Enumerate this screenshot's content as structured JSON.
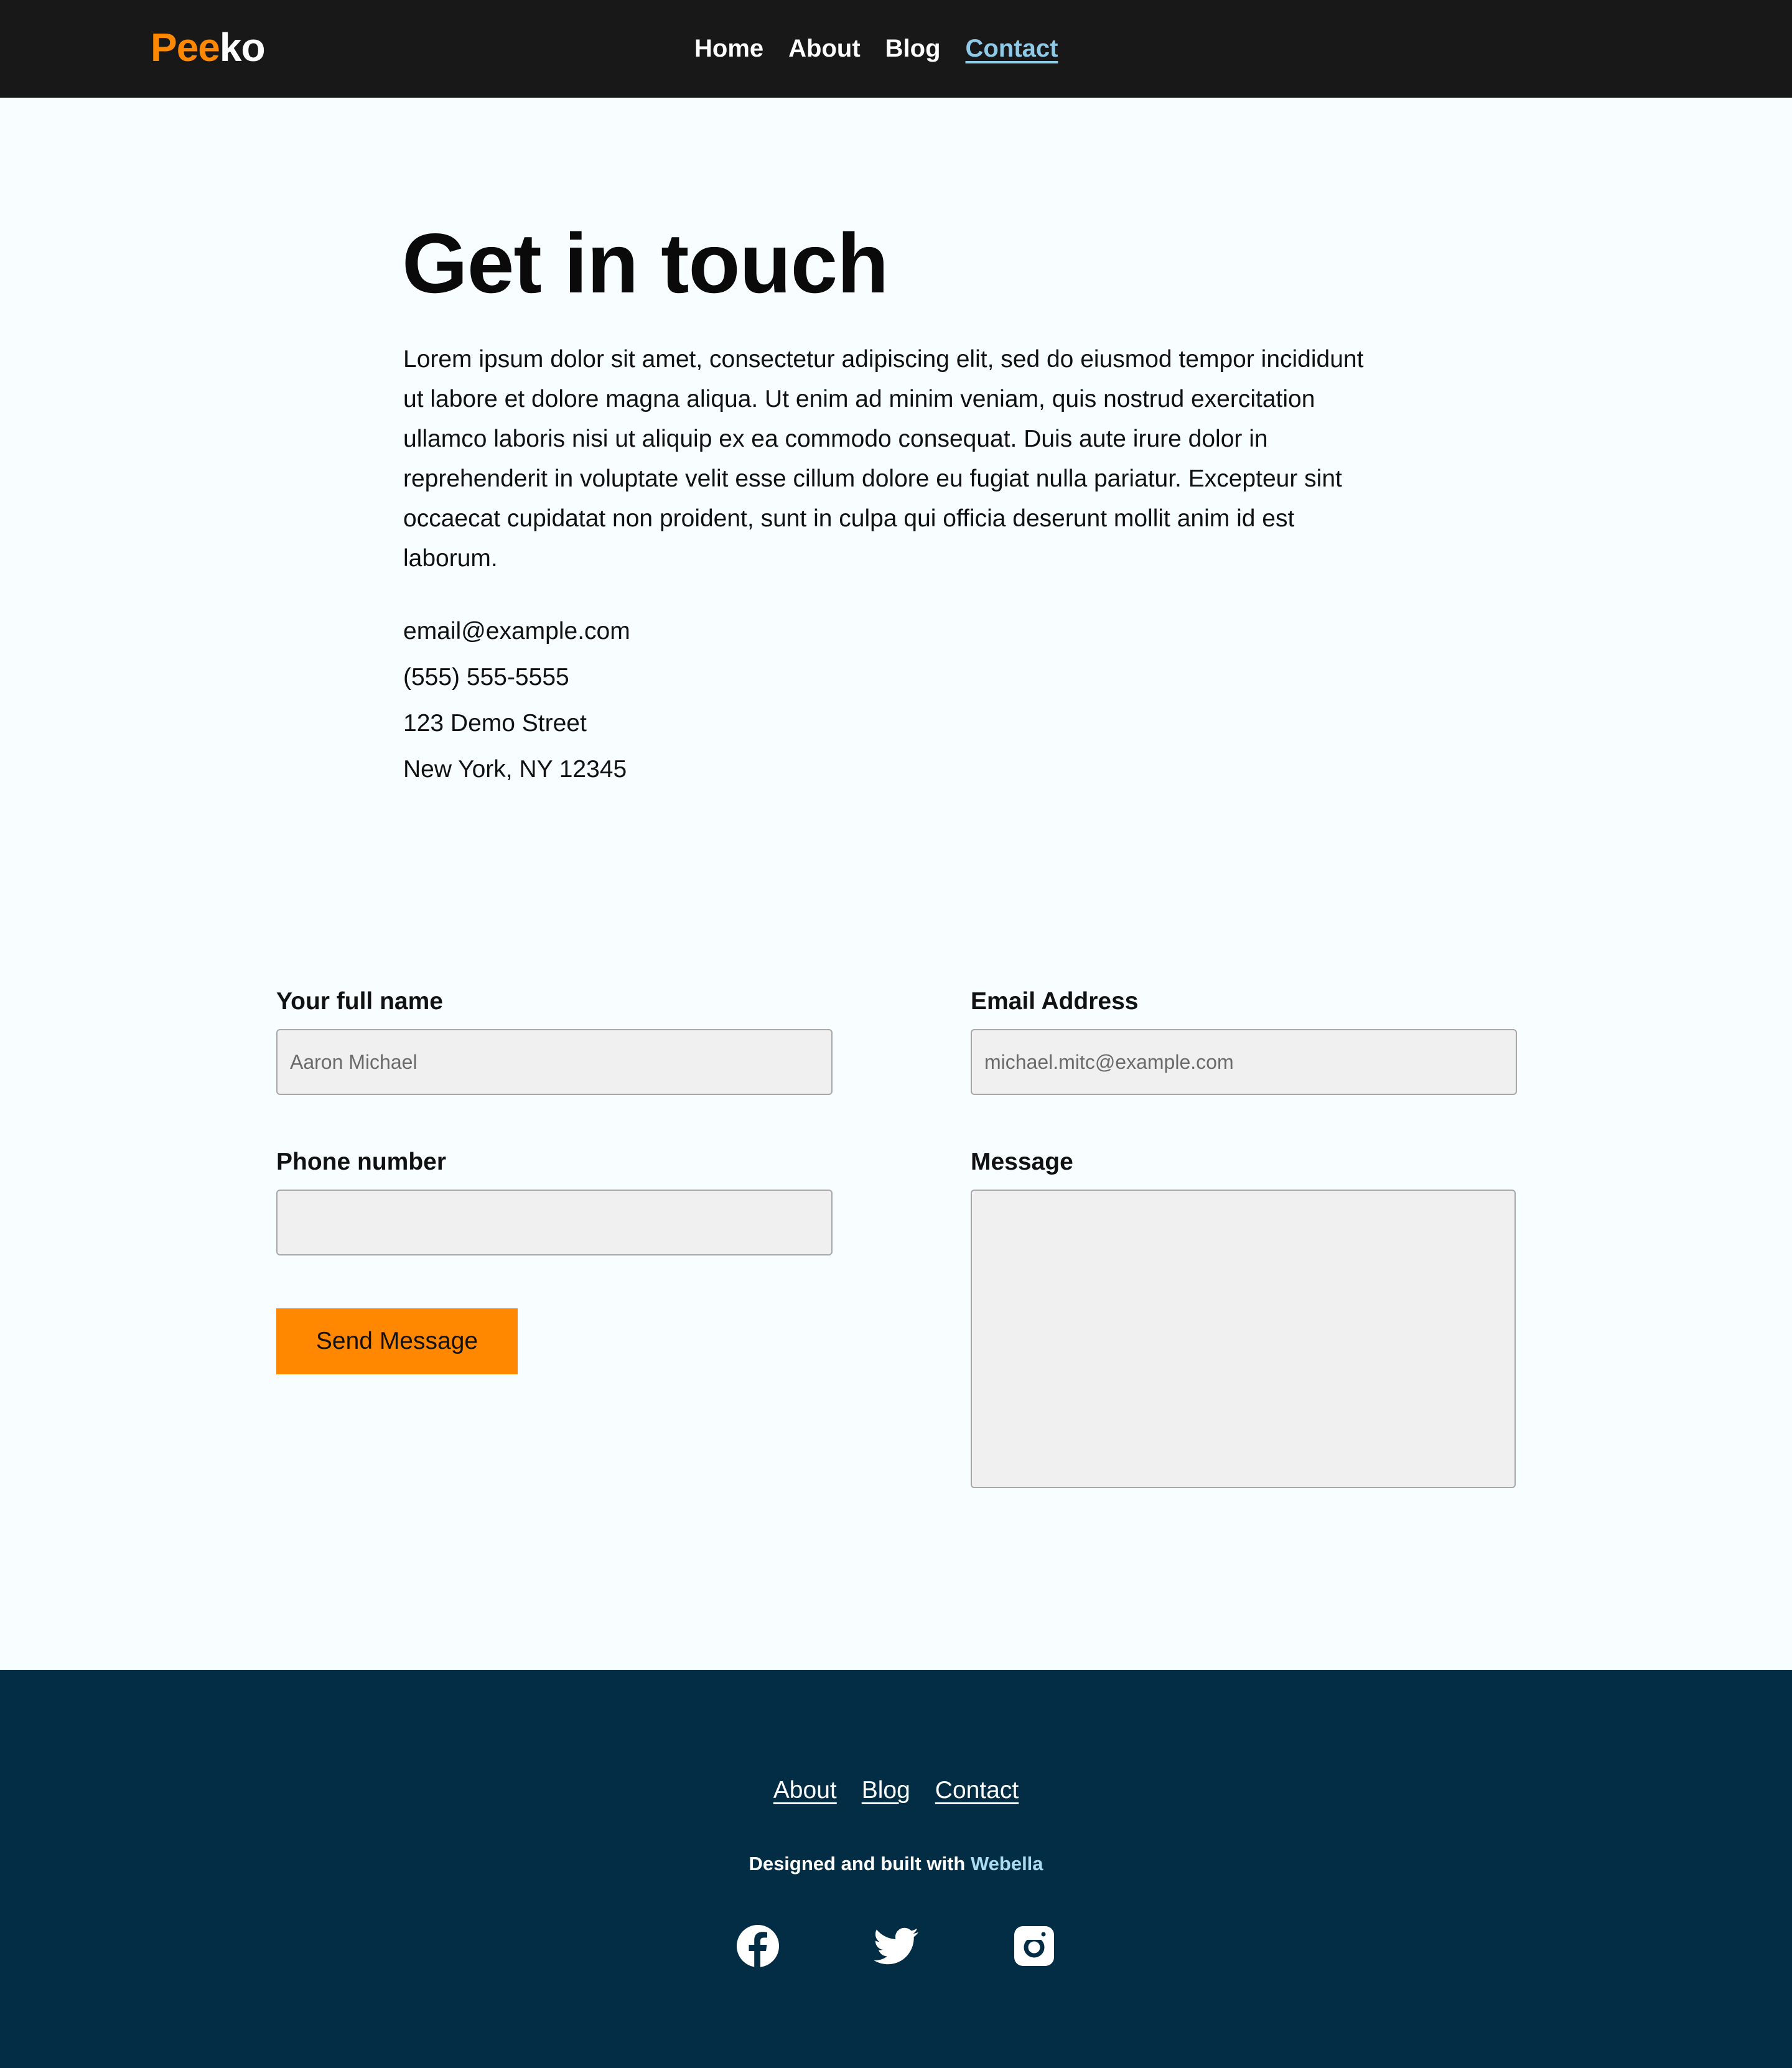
{
  "header": {
    "logo_part1": "Pee",
    "logo_part2": "ko",
    "nav": {
      "home": "Home",
      "about": "About",
      "blog": "Blog",
      "contact": "Contact"
    },
    "active_nav": "Contact"
  },
  "intro": {
    "title": "Get in touch",
    "body": "Lorem ipsum dolor sit amet, consectetur adipiscing elit, sed do eiusmod tempor incididunt ut labore et dolore magna aliqua. Ut enim ad minim veniam, quis nostrud exercitation ullamco laboris nisi ut aliquip ex ea commodo consequat. Duis aute irure dolor in reprehenderit in voluptate velit esse cillum dolore eu fugiat nulla pariatur. Excepteur sint occaecat cupidatat non proident, sunt in culpa qui officia deserunt mollit anim id est laborum.",
    "contact": {
      "email": "email@example.com",
      "phone": "(555) 555-5555",
      "street": "123 Demo Street",
      "city": "New York, NY 12345"
    }
  },
  "form": {
    "name_label": "Your full name",
    "name_placeholder": "Aaron Michael",
    "email_label": "Email Address",
    "email_placeholder": "michael.mitc@example.com",
    "phone_label": "Phone number",
    "phone_placeholder": "",
    "message_label": "Message",
    "message_placeholder": "",
    "submit_label": "Send Message"
  },
  "footer": {
    "links": {
      "about": "About",
      "blog": "Blog",
      "contact": "Contact"
    },
    "credit_prefix": "Designed and built with",
    "credit_brand": "Webella",
    "social": [
      "facebook-icon",
      "twitter-icon",
      "instagram-icon"
    ]
  },
  "colors": {
    "header_bg": "#181818",
    "accent": "#ff8800",
    "active_link": "#8fcbe8",
    "page_bg": "#f8fdff",
    "footer_bg": "#022d45",
    "brand_link": "#a9dbf2"
  }
}
